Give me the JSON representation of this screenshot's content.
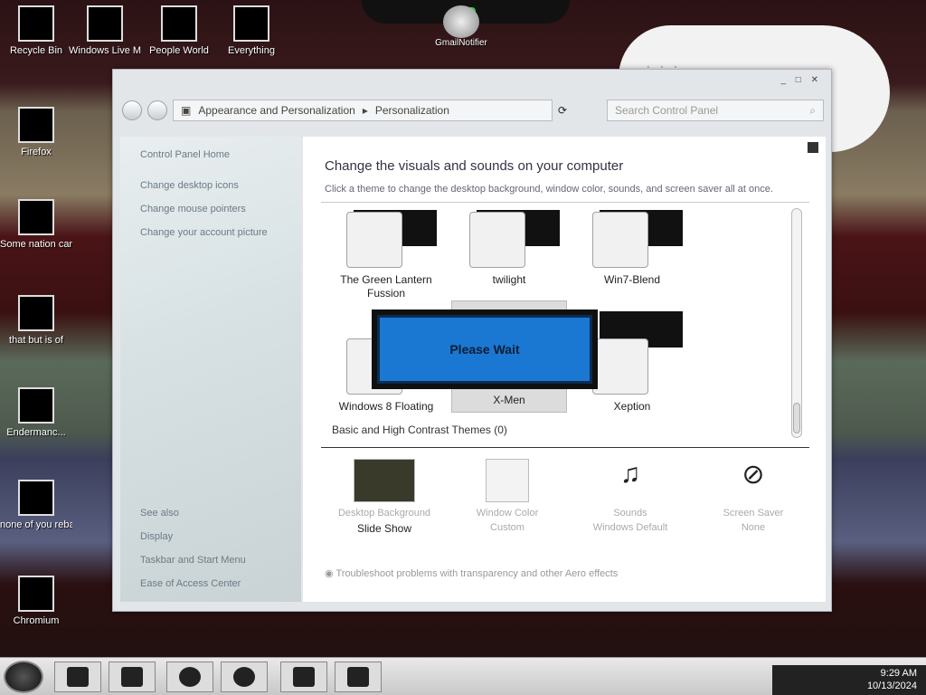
{
  "desktop": {
    "icons": [
      {
        "label": "Recycle Bin"
      },
      {
        "label": "Windows Live Mail"
      },
      {
        "label": "People World"
      },
      {
        "label": "Everything"
      },
      {
        "label": "Firefox"
      },
      {
        "label": "Some nation can a rat"
      },
      {
        "label": "that but is of"
      },
      {
        "label": "Endermanc..."
      },
      {
        "label": "none of you rebands kne..."
      },
      {
        "label": "Chromium"
      }
    ],
    "widget_label": "GmailNotifier"
  },
  "window": {
    "controls": "_ □ ✕",
    "breadcrumb": [
      "Appearance and Personalization",
      "Personalization"
    ],
    "search_placeholder": "Search Control Panel",
    "sidebar": {
      "home": "Control Panel Home",
      "links": [
        "Change desktop icons",
        "Change mouse pointers",
        "Change your account picture"
      ],
      "see_also_title": "See also",
      "see_also": [
        "Display",
        "Taskbar and Start Menu",
        "Ease of Access Center"
      ]
    },
    "main": {
      "heading": "Change the visuals and sounds on your computer",
      "subheading": "Click a theme to change the desktop background, window color, sounds, and screen saver all at once.",
      "themes": [
        {
          "name": "The Green Lantern Fussion"
        },
        {
          "name": "twilight"
        },
        {
          "name": "Win7-Blend"
        },
        {
          "name": "Windows 8 Floating"
        },
        {
          "name": "X-Men"
        },
        {
          "name": "Xeption"
        }
      ],
      "basic_section": "Basic and High Contrast Themes (0)",
      "please_wait": "Please Wait",
      "bottom": [
        {
          "t1": "Desktop Background",
          "t2": "Slide Show"
        },
        {
          "t1": "Window Color",
          "t2": "Custom"
        },
        {
          "t1": "Sounds",
          "t2": "Windows Default"
        },
        {
          "t1": "Screen Saver",
          "t2": "None"
        }
      ],
      "troubleshoot": "Troubleshoot problems with transparency and other Aero effects"
    }
  },
  "taskbar": {
    "time": "9:29 AM",
    "date": "10/13/2024"
  },
  "colors": {
    "please_wait_bg": "#1a78d2",
    "dock_led": "#2ecc40"
  }
}
